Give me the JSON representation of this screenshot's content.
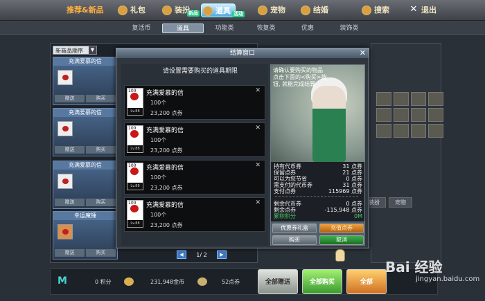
{
  "nav": {
    "items": [
      {
        "label": "推荐&新品"
      },
      {
        "label": "礼包"
      },
      {
        "label": "装扮",
        "badge": "新品"
      },
      {
        "label": "道具",
        "badge": "活动"
      },
      {
        "label": "宠物"
      },
      {
        "label": "结婚"
      },
      {
        "label": "搜索"
      },
      {
        "label": "退出"
      }
    ]
  },
  "subtabs": [
    "复活币",
    "道具",
    "功能类",
    "恢复类",
    "优惠",
    "装饰类"
  ],
  "sort_select": "新商品顺序",
  "bg_cards": [
    {
      "title": "充满爱慕的信",
      "btn1": "赠送",
      "btn2": "购买"
    },
    {
      "title": "充满爱慕的信",
      "btn1": "赠送",
      "btn2": "购买"
    },
    {
      "title": "充满爱慕的信",
      "btn1": "赠送",
      "btn2": "购买"
    },
    {
      "title": "幸运魔锤",
      "btn1": "赠送",
      "btn2": "购买"
    }
  ],
  "right_tabs": [
    "装扮",
    "宠物"
  ],
  "modal": {
    "title": "结算窗口",
    "close": "✕",
    "instruction": "请设置需要购买的道具期限",
    "items": [
      {
        "count_label": "100",
        "level": "Lv.88",
        "name": "充满爱慕的信",
        "qty": "100个",
        "price": "23,200 点券",
        "close": "✕"
      },
      {
        "count_label": "100",
        "level": "Lv.88",
        "name": "充满爱慕的信",
        "qty": "100个",
        "price": "23,200 点券",
        "close": "✕"
      },
      {
        "count_label": "100",
        "level": "Lv.88",
        "name": "充满爱慕的信",
        "qty": "100个",
        "price": "23,200 点券",
        "close": "✕"
      },
      {
        "count_label": "100",
        "level": "Lv.88",
        "name": "充满爱慕的信",
        "qty": "100个",
        "price": "23,200 点券",
        "close": "✕"
      }
    ],
    "pager": {
      "prev": "◀",
      "text": "1/ 2",
      "next": "▶"
    },
    "portrait_text": "请确认要购买的物品 点击下面的<购买>按钮, 就能完成结算",
    "summary": [
      {
        "label": "持有代币券",
        "value": "31 点券"
      },
      {
        "label": "保留点券",
        "value": "21 点券"
      },
      {
        "label": "可以为您节省",
        "value": "0 点券"
      },
      {
        "label": "需支付的代币券",
        "value": "31 点券"
      },
      {
        "label": "支付点券",
        "value": "115969 点券"
      },
      {
        "label": "剩余代币券",
        "value": "0 点券"
      },
      {
        "label": "剩余点券",
        "value": "-115,948 点券"
      },
      {
        "label": "累积积分",
        "value": "0M"
      }
    ],
    "buttons": {
      "coupon": "优惠券礼盒",
      "charge": "充值点券",
      "buy": "购买",
      "cancel": "取消"
    }
  },
  "bottom": {
    "points": "0 积分",
    "gold": "231,948金币",
    "cash": "52点券",
    "btn_gift_all": "全部赠送",
    "btn_buy_all": "全部购买",
    "btn_other": "全部"
  },
  "watermark": "Bai 经验",
  "watermark_sub": "jingyan.baidu.com"
}
